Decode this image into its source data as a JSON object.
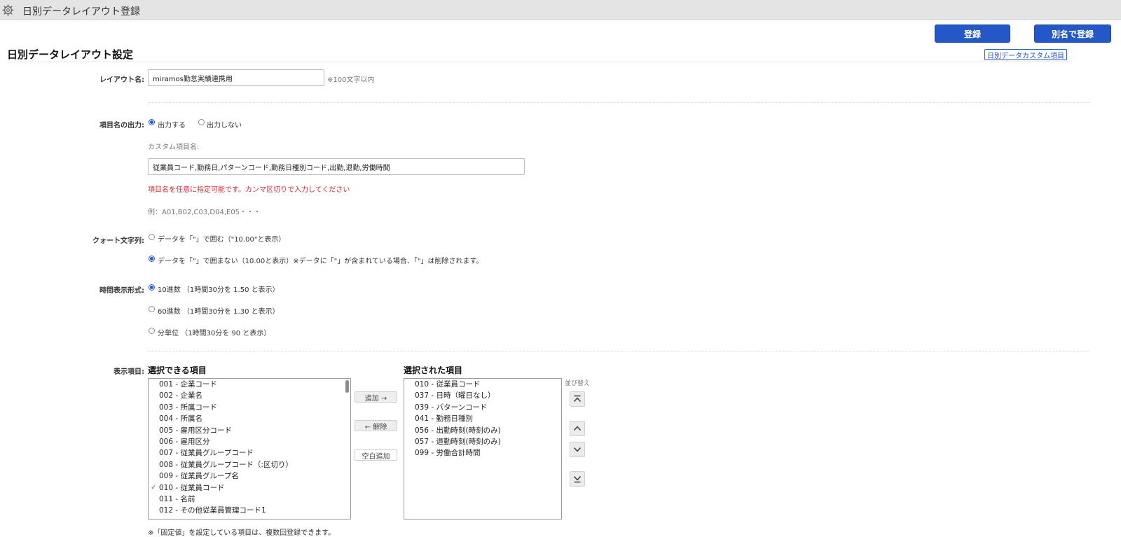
{
  "window": {
    "title": "日別データレイアウト登録"
  },
  "actions": {
    "register": "登録",
    "register_as": "別名で登録"
  },
  "section": {
    "title": "日別データレイアウト設定",
    "custom_items_link": "日別データカスタム項目"
  },
  "layout_name": {
    "label": "レイアウト名:",
    "value": "miramos勤怠実績連携用",
    "hint": "※100文字以内"
  },
  "item_name_output": {
    "label": "項目名の出力:",
    "options": [
      "出力する",
      "出力しない"
    ],
    "selected": "出力する",
    "custom_label": "カスタム項目名:",
    "custom_value": "従業員コード,勤務日,パターンコード,勤務日種別コード,出勤,退勤,労働時間",
    "note": "項目名を任意に指定可能です。カンマ区切りで入力してください",
    "example": "例：A01,B02,C03,D04,E05・・・"
  },
  "quote": {
    "label": "クォート文字列:",
    "options": [
      "データを「\"」で囲む（\"10.00\"と表示）",
      "データを「\"」で囲まない（10.00と表示）※データに「\"」が含まれている場合、「\"」は削除されます。"
    ],
    "selected_index": 1
  },
  "time_format": {
    "label": "時間表示形式:",
    "options": [
      "10進数 （1時間30分を 1.50 と表示）",
      "60進数 （1時間30分を 1.30 と表示）",
      "分単位 （1時間30分を 90 と表示）"
    ],
    "selected_index": 0
  },
  "display_items": {
    "label": "表示項目:",
    "available_title": "選択できる項目",
    "selected_title": "選択された項目",
    "sort_label": "並び替え",
    "add_button": "追加 →",
    "remove_button": "← 解除",
    "blank_button": "空白追加",
    "available": [
      {
        "text": "001 - 企業コード",
        "checked": false
      },
      {
        "text": "002 - 企業名",
        "checked": false
      },
      {
        "text": "003 - 所属コード",
        "checked": false
      },
      {
        "text": "004 - 所属名",
        "checked": false
      },
      {
        "text": "005 - 雇用区分コード",
        "checked": false
      },
      {
        "text": "006 - 雇用区分",
        "checked": false
      },
      {
        "text": "007 - 従業員グループコード",
        "checked": false
      },
      {
        "text": "008 - 従業員グループコード（:区切り）",
        "checked": false
      },
      {
        "text": "009 - 従業員グループ名",
        "checked": false
      },
      {
        "text": "010 - 従業員コード",
        "checked": true
      },
      {
        "text": "011 - 名前",
        "checked": false
      },
      {
        "text": "012 - その他従業員管理コード1",
        "checked": false
      }
    ],
    "selected": [
      "010 - 従業員コード",
      "037 - 日時（曜日なし）",
      "039 - パターンコード",
      "041 - 勤務日種別",
      "056 - 出勤時刻(時刻のみ)",
      "057 - 退勤時刻(時刻のみ)",
      "099 - 労働合計時間"
    ],
    "footnote": "※「固定値」を設定している項目は、複数回登録できます。"
  },
  "colors": {
    "accent": "#2458c9",
    "note_red": "#d0303a",
    "check_green": "#2e9b3e"
  }
}
